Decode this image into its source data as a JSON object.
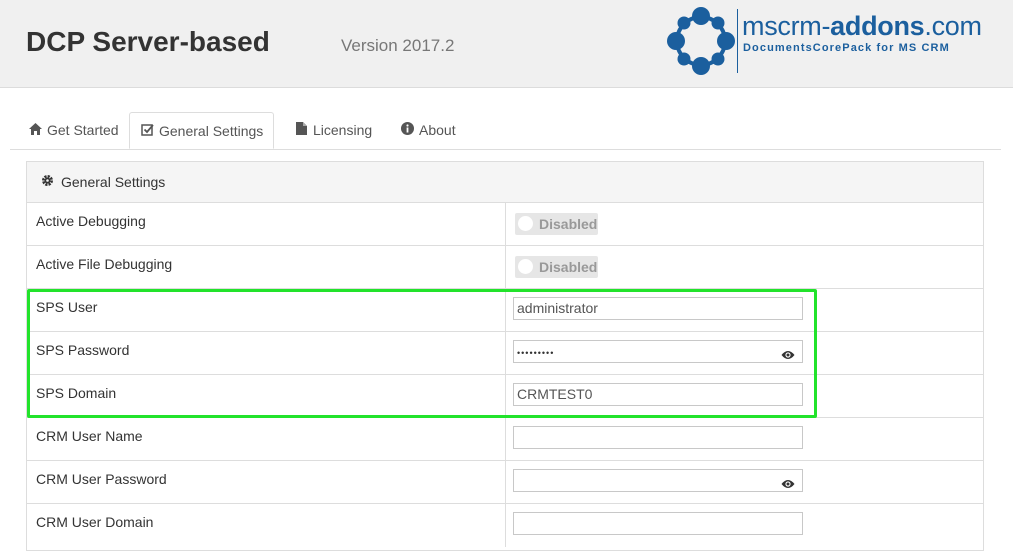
{
  "header": {
    "title": "DCP Server-based",
    "version": "Version 2017.2",
    "logo": {
      "name_prefix": "mscrm-",
      "name_bold": "addons",
      "name_suffix": ".com",
      "tagline": "DocumentsCorePack for MS CRM",
      "color": "#1b5f9e"
    }
  },
  "tabs": [
    {
      "label": "Get Started",
      "icon": "home-icon"
    },
    {
      "label": "General Settings",
      "icon": "checkbox-edit-icon",
      "active": true
    },
    {
      "label": "Licensing",
      "icon": "document-icon"
    },
    {
      "label": "About",
      "icon": "info-icon"
    }
  ],
  "panel": {
    "title": "General Settings",
    "icon": "gear-icon"
  },
  "settings": [
    {
      "label": "Active Debugging",
      "type": "toggle",
      "value": "Disabled"
    },
    {
      "label": "Active File Debugging",
      "type": "toggle",
      "value": "Disabled"
    },
    {
      "label": "SPS User",
      "type": "text",
      "value": "administrator"
    },
    {
      "label": "SPS Password",
      "type": "password",
      "value": "•••••••••"
    },
    {
      "label": "SPS Domain",
      "type": "text",
      "value": "CRMTEST0"
    },
    {
      "label": "CRM User Name",
      "type": "text",
      "value": ""
    },
    {
      "label": "CRM User Password",
      "type": "password",
      "value": ""
    },
    {
      "label": "CRM User Domain",
      "type": "text",
      "value": ""
    }
  ],
  "colors": {
    "highlight": "#22e32b",
    "toggle_bg": "#e6e6e6"
  }
}
